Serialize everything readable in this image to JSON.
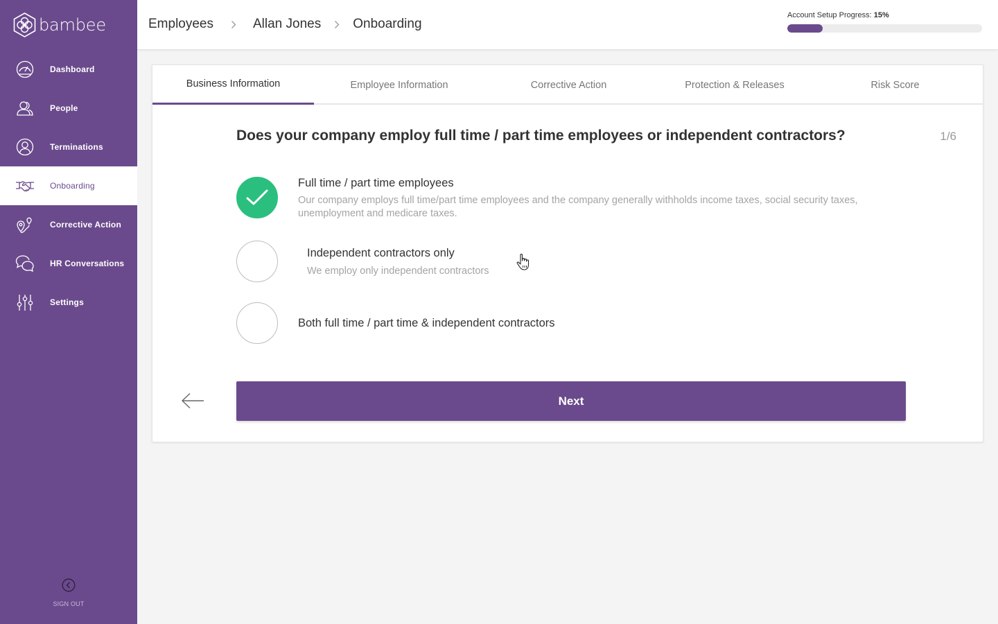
{
  "sidebar": {
    "logo_text": "bambee",
    "items": [
      {
        "label": "Dashboard",
        "icon": "gauge-icon"
      },
      {
        "label": "People",
        "icon": "people-icon"
      },
      {
        "label": "Terminations",
        "icon": "person-circle-icon"
      },
      {
        "label": "Onboarding",
        "icon": "handshake-icon",
        "active": true
      },
      {
        "label": "Corrective Action",
        "icon": "location-pins-icon"
      },
      {
        "label": "HR Conversations",
        "icon": "chat-bubbles-icon"
      },
      {
        "label": "Settings",
        "icon": "sliders-icon"
      }
    ],
    "signout_label": "SIGN OUT"
  },
  "header": {
    "breadcrumb": [
      "Employees",
      "Allan Jones",
      "Onboarding"
    ],
    "progress_label": "Account Setup Progress:",
    "progress_value": "15%",
    "progress_fraction": 0.18
  },
  "tabs": [
    "Business Information",
    "Employee Information",
    "Corrective Action",
    "Protection & Releases",
    "Risk Score"
  ],
  "active_tab": "Business Information",
  "question": {
    "text": "Does your company employ full time / part time employees or independent contractors?",
    "step": "1/6"
  },
  "options": [
    {
      "title": "Full time / part time employees",
      "description": "Our company employs full time/part time employees and the company generally withholds income taxes, social security taxes, unemployment and medicare taxes.",
      "selected": true
    },
    {
      "title": "Independent contractors only",
      "description": "We employ only independent contractors",
      "selected": false
    },
    {
      "title": "Both full time / part time & independent contractors",
      "description": "",
      "selected": false
    }
  ],
  "next_label": "Next",
  "colors": {
    "brand": "#6a4a8c",
    "selected": "#2bbf7f",
    "muted_text": "#a4a4a4"
  }
}
